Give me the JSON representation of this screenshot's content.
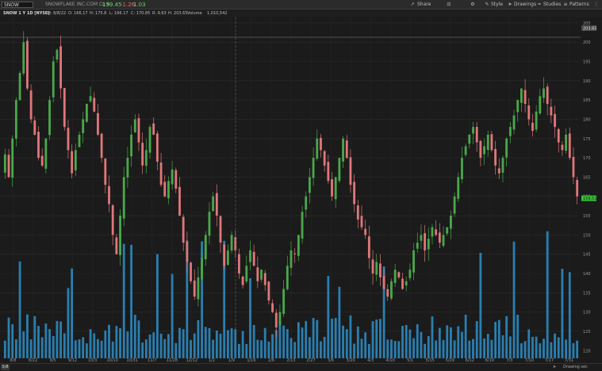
{
  "header": {
    "symbol": "SNOW",
    "company": "SNOWFLAKE INC.COM CL A",
    "last": "159.45",
    "change": "-1.26",
    "change_pct": "1.03",
    "tools": [
      {
        "label": "Share",
        "icon": "share-icon"
      },
      {
        "label": "",
        "icon": "flask-icon"
      },
      {
        "label": "",
        "icon": "gear-icon"
      },
      {
        "label": "Style",
        "icon": "style-icon"
      },
      {
        "label": "Drawings",
        "icon": "cursor-icon"
      },
      {
        "label": "Studies",
        "icon": "studies-icon"
      },
      {
        "label": "Patterns",
        "icon": "patterns-icon"
      }
    ]
  },
  "subheader": {
    "study": "SNOW 1 Y 1D [NYSE]",
    "date": "D: 8/8/22",
    "open": "O: 166.17",
    "high": "H: 175.8",
    "low": "L: 166.17",
    "close": "C: 170.85",
    "range": "R: 9.63",
    "high2": "H: 203.65",
    "volume_label": "Volume",
    "volume": "1,010,542"
  },
  "chart_data": {
    "type": "candlestick",
    "price_axis": {
      "ticks": [
        "205",
        "200",
        "195",
        "190",
        "185",
        "180",
        "175",
        "170",
        "165",
        "160",
        "155",
        "150",
        "145",
        "140",
        "135",
        "130",
        "125",
        "120"
      ],
      "high_marker": "203.65",
      "last_marker": "159.51",
      "ylim": [
        118,
        206
      ]
    },
    "time_axis": {
      "ticks": [
        "8/8",
        "8/22",
        "9/5",
        "9/12",
        "10/3",
        "10/10",
        "10/31",
        "11/7",
        "11/28",
        "12/12",
        "1/2",
        "1/9",
        "1/16",
        "2/6",
        "2/13",
        "2/27",
        "3/6",
        "3/20",
        "4/3",
        "4/10",
        "5/1",
        "5/15",
        "5/29",
        "6/12",
        "6/19",
        "7/3",
        "7/10",
        "7/17",
        "7/31"
      ]
    },
    "grid": true,
    "close_series": [
      170.9,
      165,
      175,
      185,
      192,
      200,
      188,
      180,
      176,
      170,
      168,
      175,
      185,
      195,
      198,
      188,
      178,
      172,
      166,
      172,
      176,
      180,
      184,
      186,
      182,
      176,
      170,
      163,
      158,
      150,
      145,
      155,
      165,
      170,
      176,
      180,
      174,
      168,
      172,
      178,
      176,
      169,
      163,
      160,
      164,
      167,
      162,
      155,
      148,
      143,
      138,
      134,
      139,
      144,
      150,
      156,
      160,
      155,
      148,
      142,
      146,
      150,
      146,
      140,
      137,
      142,
      146,
      142,
      138,
      141,
      137,
      133,
      130,
      126,
      130,
      136,
      142,
      146,
      145,
      150,
      156,
      160,
      165,
      170,
      175,
      172,
      168,
      164,
      160,
      165,
      170,
      175,
      170,
      163,
      158,
      154,
      152,
      150,
      144,
      140,
      143,
      139,
      136,
      134,
      138,
      141,
      139,
      136,
      138,
      141,
      146,
      148,
      150,
      146,
      149,
      152,
      150,
      148,
      150,
      152,
      155,
      160,
      165,
      170,
      173,
      176,
      178,
      174,
      170,
      173,
      176,
      172,
      168,
      166,
      170,
      175,
      178,
      181,
      185,
      188,
      184,
      180,
      177,
      182,
      186,
      188,
      184,
      181,
      178,
      174,
      172,
      176,
      170,
      165,
      160
    ]
  },
  "footer": {
    "period": "5/8",
    "drawing_set": "Drawing set: Default"
  }
}
